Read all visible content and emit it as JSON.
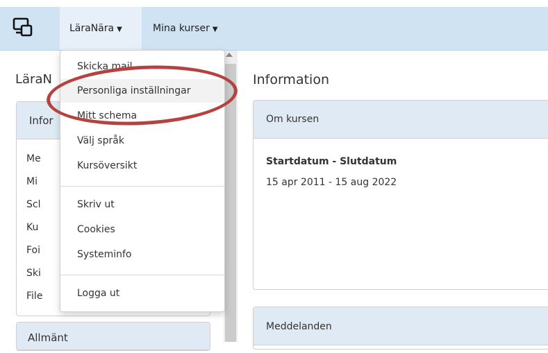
{
  "navbar": {
    "brand_icon": "devices-icon",
    "menus": [
      {
        "label": "LäraNära"
      },
      {
        "label": "Mina kurser"
      }
    ]
  },
  "sidebar": {
    "title": "LäraN",
    "panel1": {
      "heading": "Infor",
      "items": [
        "Me",
        "Mi",
        "Scl",
        "Ku",
        "Foi",
        "Ski",
        "File"
      ]
    },
    "panel2": {
      "heading": "Allmänt"
    }
  },
  "main": {
    "title": "Information",
    "course_panel": {
      "heading": "Om kursen",
      "date_label": "Startdatum - Slutdatum",
      "date_value": "15 apr 2011 - 15 aug 2022"
    },
    "messages_panel": {
      "heading": "Meddelanden"
    }
  },
  "dropdown": {
    "group1": [
      "Skicka mail",
      "Personliga inställningar",
      "Mitt schema",
      "Välj språk",
      "Kursöversikt"
    ],
    "group2": [
      "Skriv ut",
      "Cookies",
      "Systeminfo"
    ],
    "group3": [
      "Logga ut"
    ]
  },
  "colors": {
    "navbar": "#cfe3f2",
    "panel_heading": "#dfeaf4",
    "highlight_oval": "#b5423f"
  }
}
